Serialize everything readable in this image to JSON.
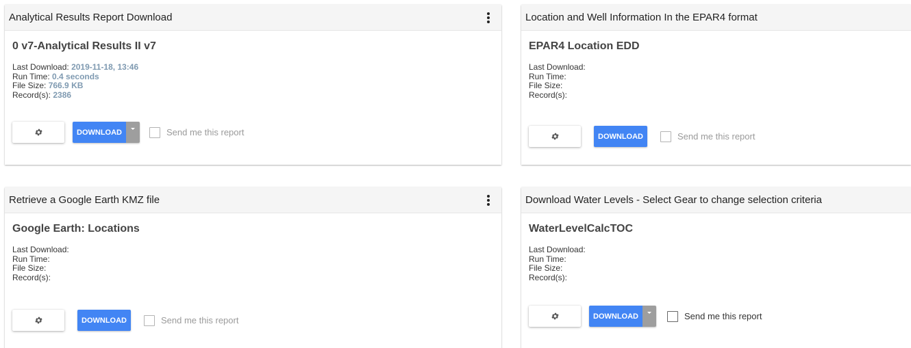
{
  "cards": [
    {
      "header": "Analytical Results Report Download",
      "report_name": "0 v7-Analytical Results II v7",
      "labels": {
        "last_download": "Last Download:",
        "run_time": "Run Time:",
        "file_size": "File Size:",
        "records": "Record(s):"
      },
      "values": {
        "last_download": "2019-11-18, 13:46",
        "run_time": "0.4 seconds",
        "file_size": "766.9 KB",
        "records": "2386"
      },
      "download_label": "DOWNLOAD",
      "send_label": "Send me this report"
    },
    {
      "header": "Location and Well Information In the EPAR4 format",
      "report_name": "EPAR4 Location EDD",
      "labels": {
        "last_download": "Last Download:",
        "run_time": "Run Time:",
        "file_size": "File Size:",
        "records": "Record(s):"
      },
      "download_label": "DOWNLOAD",
      "send_label": "Send me this report"
    },
    {
      "header": "Retrieve a Google Earth KMZ file",
      "report_name": "Google Earth: Locations",
      "labels": {
        "last_download": "Last Download:",
        "run_time": "Run Time:",
        "file_size": "File Size:",
        "records": "Record(s):"
      },
      "download_label": "DOWNLOAD",
      "send_label": "Send me this report"
    },
    {
      "header": "Download Water Levels - Select Gear to change selection criteria",
      "report_name": "WaterLevelCalcTOC",
      "labels": {
        "last_download": "Last Download:",
        "run_time": "Run Time:",
        "file_size": "File Size:",
        "records": "Record(s):"
      },
      "download_label": "DOWNLOAD",
      "send_label": "Send me this report"
    }
  ],
  "icons": {
    "menu": "more-vert-icon",
    "settings": "gear-icon",
    "dropdown": "caret-down-icon"
  },
  "colors": {
    "download_button": "#4285f4",
    "caret_button": "#9e9e9e",
    "value_text": "#7f9ab1",
    "header_bg": "#f5f5f5"
  }
}
